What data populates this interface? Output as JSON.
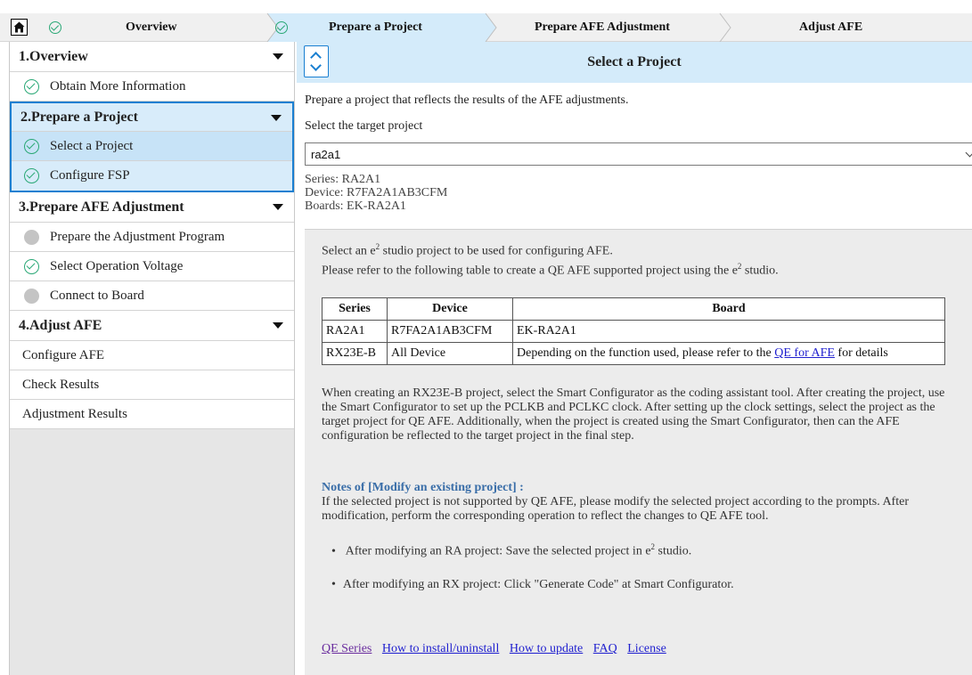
{
  "steps": [
    {
      "label": "Overview",
      "done": true
    },
    {
      "label": "Prepare a Project",
      "done": true
    },
    {
      "label": "Prepare AFE Adjustment",
      "done": false
    },
    {
      "label": "Adjust AFE",
      "done": false
    }
  ],
  "sidebar": {
    "sections": [
      {
        "title": "1.Overview",
        "items": [
          {
            "label": "Obtain More Information",
            "status": "done"
          }
        ]
      },
      {
        "title": "2.Prepare a Project",
        "items": [
          {
            "label": "Select a Project",
            "status": "done"
          },
          {
            "label": "Configure FSP",
            "status": "done"
          }
        ]
      },
      {
        "title": "3.Prepare AFE Adjustment",
        "items": [
          {
            "label": "Prepare the Adjustment Program",
            "status": "todo"
          },
          {
            "label": "Select Operation Voltage",
            "status": "done"
          },
          {
            "label": "Connect to Board",
            "status": "todo"
          }
        ]
      },
      {
        "title": "4.Adjust AFE",
        "items": [
          {
            "label": "Configure AFE",
            "status": "none"
          },
          {
            "label": "Check Results",
            "status": "none"
          },
          {
            "label": "Adjustment Results",
            "status": "none"
          }
        ]
      }
    ]
  },
  "main": {
    "title": "Select a Project",
    "intro": "Prepare a project that reflects the results of the AFE adjustments.",
    "select_label": "Select the target project",
    "selected_project": "ra2a1",
    "series_line": "Series:  RA2A1",
    "device_line": "Device:  R7FA2A1AB3CFM",
    "boards_line": "Boards:  EK-RA2A1",
    "info": {
      "line1_pre": "Select an e",
      "line1_sup": "2",
      "line1_post": " studio project to be used for configuring AFE.",
      "line2_pre": "Please refer to the following table to create a QE AFE supported project using the e",
      "line2_sup": "2",
      "line2_post": " studio.",
      "table": {
        "headers": [
          "Series",
          "Device",
          "Board"
        ],
        "rows": [
          [
            "RA2A1",
            "R7FA2A1AB3CFM",
            "EK-RA2A1"
          ],
          [
            "RX23E-B",
            "All Device",
            "Depending on the function used, please refer to the "
          ]
        ],
        "link_text": "QE for AFE",
        "link_suffix": " for details"
      },
      "rx_paragraph": "When creating an RX23E-B project, select the Smart Configurator as the coding assistant tool. After creating the project, use the Smart Configurator to set up the PCLKB and PCLKC clock. After setting up the clock settings, select the project as the target project for QE AFE. Additionally, when the project is created using the Smart Configurator, then can the AFE configuration be reflected to the target project in the final step.",
      "notes_title": "Notes of [Modify an existing project] :",
      "notes_paragraph": "If the selected project is not supported by QE AFE, please modify the selected project according to the prompts. After modification, perform the corresponding operation to reflect the changes to QE AFE tool.",
      "bullet1_pre": "After modifying an RA project: Save the selected project in e",
      "bullet1_sup": "2",
      "bullet1_post": " studio.",
      "bullet2": "After modifying an RX project: Click \"Generate Code\" at Smart Configurator."
    },
    "footer_links": [
      "QE Series",
      "How to install/uninstall",
      "How to update",
      "FAQ",
      "License"
    ]
  }
}
